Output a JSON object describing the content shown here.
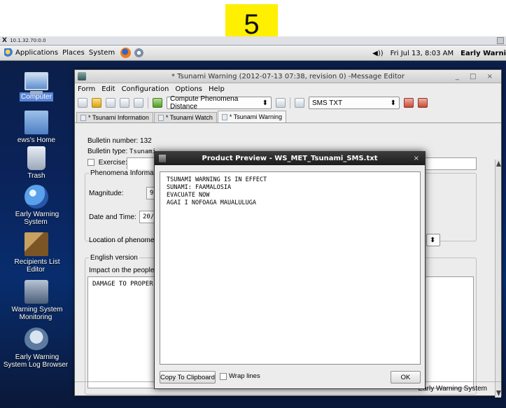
{
  "step_badge": "5",
  "x_window": {
    "title": "10.1.32.70:0.0"
  },
  "top_panel": {
    "menus": [
      "Applications",
      "Places",
      "System"
    ],
    "datetime": "Fri Jul 13,  8:03 AM",
    "user_app": "Early Warni"
  },
  "desktop_icons": [
    {
      "label": "Computer",
      "icon": "computer-icon"
    },
    {
      "label": "ews's Home",
      "icon": "home-folder-icon"
    },
    {
      "label": "Trash",
      "icon": "trash-icon"
    },
    {
      "label": "Early Warning\nSystem",
      "icon": "globe-icon"
    },
    {
      "label": "Recipients List\nEditor",
      "icon": "edit-icon"
    },
    {
      "label": "Warning System\nMonitoring",
      "icon": "monitoring-icon"
    },
    {
      "label": "Early Warning\nSystem Log Browser",
      "icon": "log-browser-icon"
    }
  ],
  "editor": {
    "title": "* Tsunami Warning (2012-07-13 07:38, revision 0) -Message Editor",
    "window_controls": "_ □ ×",
    "menu": [
      "Form",
      "Edit",
      "Configuration",
      "Options",
      "Help"
    ],
    "toolbar": {
      "distance_combo": "Compute Phenomena Distance",
      "format_combo": "SMS TXT"
    },
    "tabs": [
      "* Tsunami Information",
      "* Tsunami Watch",
      "* Tsunami Warning"
    ],
    "form": {
      "bulletin_number": "Bulletin number: 132",
      "bulletin_type_label": "Bulletin type:",
      "bulletin_type_value": "Tsunami",
      "exercise_label": "Exercise:",
      "phenomena_group": "Phenomena Informatic",
      "magnitude_label": "Magnitude:",
      "magnitude_value": "9",
      "date_time_label": "Date and Time:",
      "date_time_value": "20/",
      "location_label": "Location of phenomena",
      "english_group": "English version",
      "impact_label": "Impact on the people:",
      "impact_value": "DAMAGE TO PROPER"
    },
    "status_text": "Early Warning System"
  },
  "preview": {
    "title": "Product Preview - WS_MET_Tsunami_SMS.txt",
    "close": "×",
    "text": "TSUNAMI WARNING IS IN EFFECT\nSUNAMI: FAAMALOSIA\nEVACUATE NOW\nAGAI I NOFOAGA MAUALULUGA",
    "copy_button": "Copy To Clipboard",
    "wrap_label": "Wrap lines",
    "ok_button": "OK"
  },
  "colors": {
    "badge": "#ffef00",
    "desktop": "#0a2258",
    "selection": "#5b86d6"
  }
}
